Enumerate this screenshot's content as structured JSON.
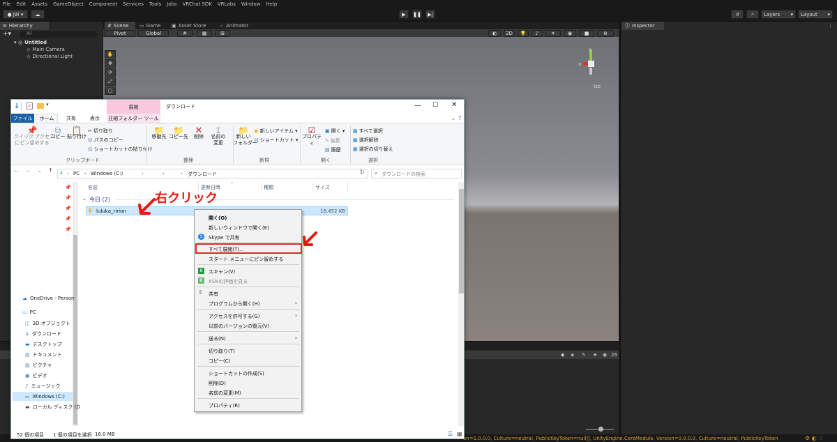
{
  "unity": {
    "menu": [
      "File",
      "Edit",
      "Assets",
      "GameObject",
      "Component",
      "Services",
      "Tools",
      "Jobs",
      "VRChat SDK",
      "VRLabs",
      "Window",
      "Help"
    ],
    "account": "JW ▾",
    "layers": "Layers",
    "layout": "Layout",
    "hierarchy": {
      "tab": "Hierarchy",
      "search": "All",
      "scene": "Untitled",
      "items": [
        "Main Camera",
        "Directional Light"
      ]
    },
    "scene_tabs": {
      "scene": "Scene",
      "game": "Game",
      "asset_store": "Asset Store",
      "animator": "Animator"
    },
    "scene_toolbar": {
      "pivot": "Pivot",
      "global": "Global",
      "mode_2d": "2D"
    },
    "gizmo": {
      "label": "Iso",
      "y": "y",
      "x": "x"
    },
    "inspector": {
      "tab": "Inspector"
    },
    "bottom_count": "26",
    "status_text": "on=1.0.0.0, Culture=neutral, PublicKeyToken=null]], UnityEngine.CoreModule, Version=0.0.0.0, Culture=neutral, PublicKeyToken"
  },
  "explorer": {
    "context_tab": "展開",
    "title": "ダウンロード",
    "tabs": {
      "file": "ファイル",
      "home": "ホーム",
      "share": "共有",
      "view": "表示",
      "compressed": "圧縮フォルダー ツール"
    },
    "ribbon": {
      "pin_quick": "クイック アクセス\nにピン留めする",
      "copy": "コピー",
      "paste": "貼り付け",
      "cut": "切り取り",
      "copy_path": "パスのコピー",
      "paste_shortcut": "ショートカットの貼り付け",
      "clipboard": "クリップボード",
      "move_to": "移動先",
      "copy_to": "コピー先",
      "delete": "削除",
      "rename": "名前の\n変更",
      "organize": "整理",
      "new_folder": "新しい\nフォルダー",
      "new_item": "新しいアイテム ▾",
      "shortcut": "ショートカット ▾",
      "new": "新規",
      "properties": "プロパティ",
      "open": "開く ▾",
      "edit": "編集",
      "history": "履歴",
      "open_group": "開く",
      "select_all": "すべて選択",
      "select_none": "選択解除",
      "invert": "選択の切り替え",
      "select": "選択"
    },
    "address": {
      "pc": "PC",
      "drive": "Windows (C:)",
      "folder": "ダウンロード"
    },
    "search_placeholder": "ダウンロードの検索",
    "columns": {
      "name": "名前",
      "date": "更新日時",
      "type": "種類",
      "size": "サイズ"
    },
    "group": "今日 (2)",
    "file": {
      "name": "luluka_ririon",
      "size": "16,452 KB"
    },
    "nav": [
      "OneDrive - Person",
      "PC",
      "3D オブジェクト",
      "ダウンロード",
      "デスクトップ",
      "ドキュメント",
      "ピクチャ",
      "ビデオ",
      "ミュージック",
      "Windows (C:)",
      "ローカル ディスク (D"
    ],
    "status": {
      "count": "52 個の項目",
      "selected": "1 個の項目を選択",
      "size": "16.0 MB"
    }
  },
  "context_menu": {
    "items": [
      "開く(O)",
      "新しいウィンドウで開く(E)",
      "Skype で共有",
      "すべて展開(T)...",
      "スタート メニューにピン留めする",
      "スキャン(V)",
      "KSNの評価を見る",
      "共有",
      "プログラムから開く(H)",
      "アクセスを許可する(G)",
      "以前のバージョンの復元(V)",
      "送る(N)",
      "切り取り(T)",
      "コピー(C)",
      "ショートカットの作成(S)",
      "削除(D)",
      "名前の変更(M)",
      "プロパティ(R)"
    ]
  },
  "annotation": {
    "label": "右クリック",
    "color": "#e8170f"
  }
}
